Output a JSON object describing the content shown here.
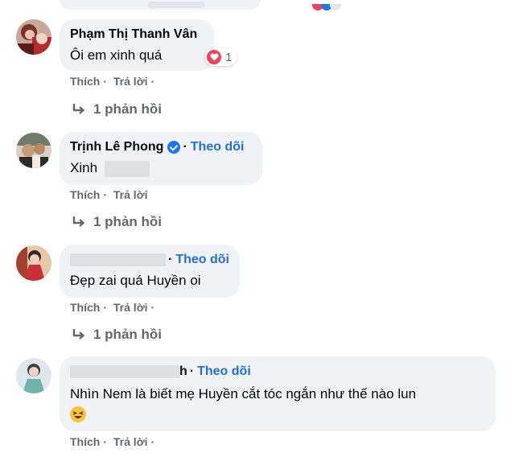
{
  "comments": [
    {
      "author": "Phạm Thị Thanh Vân",
      "text": "Ôi em xinh quá",
      "reaction_count": "1",
      "like_label": "Thích",
      "reply_label": "Trả lời",
      "replies_label": "1 phản hồi"
    },
    {
      "author": "Trịnh Lê Phong",
      "follow_label": "Theo dõi",
      "text": "Xinh",
      "like_label": "Thích",
      "reply_label": "Trả lời",
      "replies_label": "1 phản hồi"
    },
    {
      "follow_label": "Theo dõi",
      "text": "Đẹp zai quá Huyền oi",
      "like_label": "Thích",
      "reply_label": "Trả lời",
      "replies_label": "1 phản hồi"
    },
    {
      "author_fragment": "h",
      "follow_label": "Theo dõi",
      "text": "Nhìn Nem là biết mẹ Huyền cắt tóc ngắn như thế nào lun",
      "emoji": "laughing-emoji",
      "like_label": "Thích",
      "reply_label": "Trả lời"
    }
  ],
  "separator": "·",
  "colors": {
    "bubble": "#f0f2f5",
    "follow": "#216fdb",
    "meta": "#65676b",
    "heart": "#f33e58"
  }
}
